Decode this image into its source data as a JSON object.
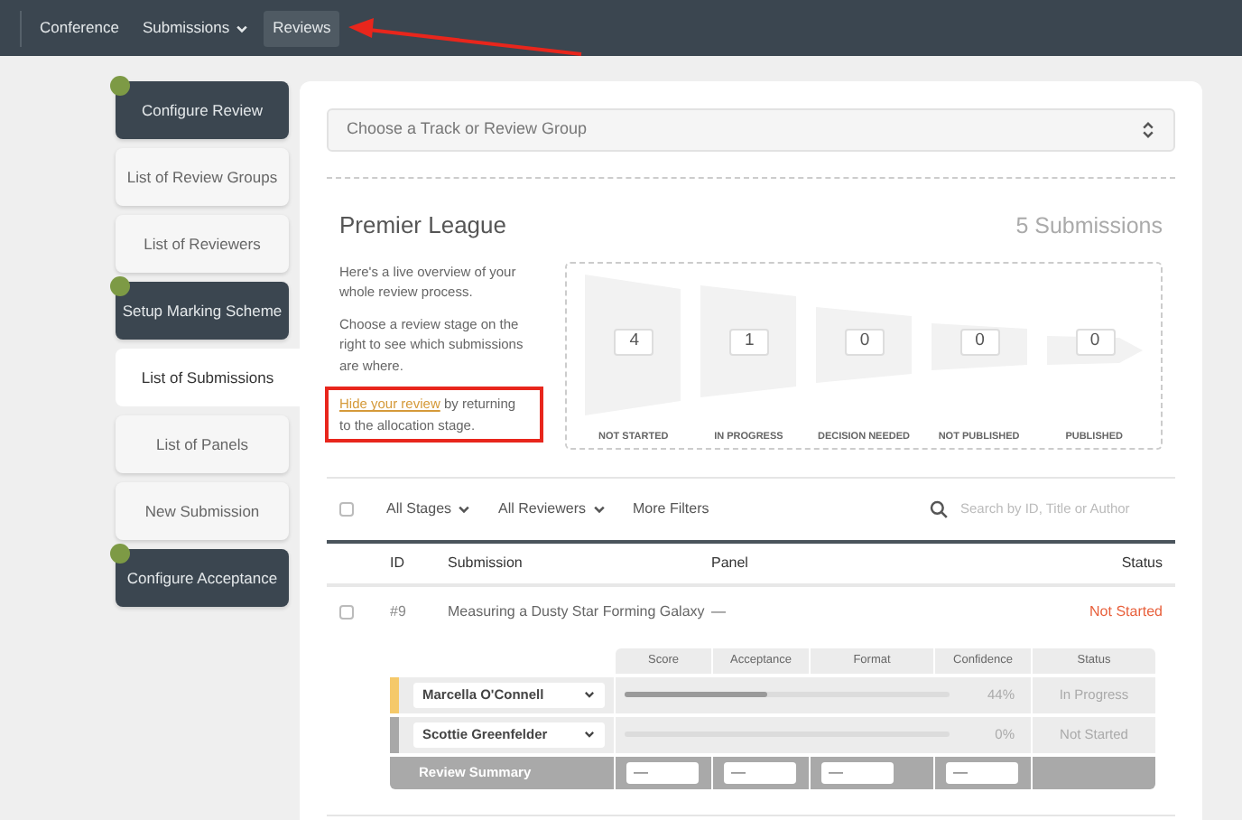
{
  "nav": {
    "items": [
      {
        "label": "Conference",
        "dropdown": false,
        "selected": false
      },
      {
        "label": "Submissions",
        "dropdown": true,
        "selected": false
      },
      {
        "label": "Reviews",
        "dropdown": false,
        "selected": true
      }
    ]
  },
  "sidebar": {
    "items": [
      {
        "label": "Configure Review",
        "kind": "stage",
        "selected": false
      },
      {
        "label": "List of Review Groups",
        "kind": "page",
        "selected": false
      },
      {
        "label": "List of Reviewers",
        "kind": "page",
        "selected": false
      },
      {
        "label": "Setup Marking Scheme",
        "kind": "stage",
        "selected": false
      },
      {
        "label": "List of Submissions",
        "kind": "page",
        "selected": true
      },
      {
        "label": "List of Panels",
        "kind": "page",
        "selected": false
      },
      {
        "label": "New Submission",
        "kind": "page",
        "selected": false
      },
      {
        "label": "Configure Acceptance",
        "kind": "stage",
        "selected": false
      }
    ]
  },
  "track_select": {
    "placeholder": "Choose a Track or Review Group"
  },
  "overview": {
    "title": "Premier League",
    "count": "5 Submissions",
    "paragraphs": [
      "Here's a live overview of your whole review process.",
      "Choose a review stage on the right to see which submissions are where."
    ],
    "hide_link": "Hide your review",
    "hide_rest": "by returning to the allocation stage.",
    "stages": [
      {
        "label": "NOT STARTED",
        "count": "4"
      },
      {
        "label": "IN PROGRESS",
        "count": "1"
      },
      {
        "label": "DECISION NEEDED",
        "count": "0"
      },
      {
        "label": "NOT PUBLISHED",
        "count": "0"
      },
      {
        "label": "PUBLISHED",
        "count": "0"
      }
    ]
  },
  "filters": {
    "select_all": {
      "checked": false
    },
    "items": [
      "All Stages",
      "All Reviewers",
      "More Filters"
    ],
    "dropdowns": [
      true,
      true,
      false
    ],
    "search": {
      "placeholder": "Search by ID, Title or Author"
    }
  },
  "table": {
    "columns": [
      "ID",
      "Submission",
      "Panel",
      "Status"
    ],
    "rows": [
      {
        "checked": false,
        "id": "#9",
        "title": "Measuring a Dusty Star Forming Galaxy",
        "panel": "—",
        "status": "Not Started",
        "color": "#e8603c"
      }
    ]
  },
  "reviews": {
    "columns": [
      "Score",
      "Acceptance",
      "Format",
      "Confidence",
      "Status"
    ],
    "reviewers": [
      {
        "name": "Marcella O'Connell",
        "color": "#f5c96a",
        "level": 0.44,
        "progress": "44%",
        "status": "In Progress"
      },
      {
        "name": "Scottie Greenfelder",
        "color": "#a8a8a8",
        "level": 0,
        "progress": "0%",
        "status": "Not Started"
      }
    ],
    "summary": {
      "label": "Review Summary",
      "values": [
        "—",
        "—",
        "—",
        "—"
      ]
    }
  }
}
